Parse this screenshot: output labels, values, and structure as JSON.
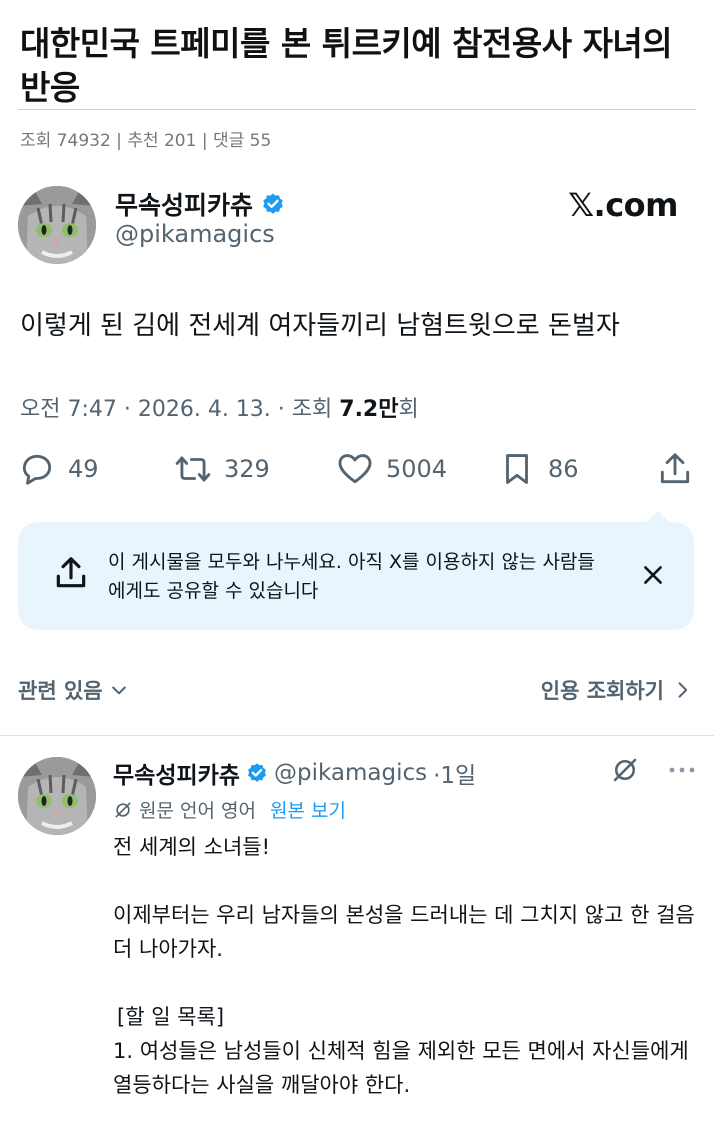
{
  "article": {
    "title": "대한민국 트페미를 본 튀르키예 참전용사 자녀의 반응",
    "views_label": "조회 74932",
    "recommend_label": "추천 201",
    "comments_label": "댓글 55",
    "separator": " | "
  },
  "tweet": {
    "name": "무속성피카츄",
    "handle": "@pikamagics",
    "site": "𝕏.com",
    "text": "이렇게 된 김에 전세계 여자들끼리 남혐트윗으로 돈벌자",
    "time_prefix": "오전 7:47 · 2026. 4. 13. · 조회 ",
    "views": "7.2만",
    "views_suffix": "회",
    "replies": "49",
    "retweets": "329",
    "likes": "5004",
    "bookmarks": "86"
  },
  "share_banner": {
    "text": "이 게시물을 모두와 나누세요. 아직 X를 이용하지 않는 사람들에게도 공유할 수 있습니다"
  },
  "related": {
    "label": "관련 있음",
    "quote_label": "인용 조회하기"
  },
  "reply": {
    "name": "무속성피카츄",
    "handle": "@pikamagics",
    "age": "·1일",
    "orig_lang": "원문 언어 영어",
    "orig_link": "원본 보기",
    "lines": {
      "l1": "전 세계의 소녀들!",
      "l2": "이제부터는 우리 남자들의 본성을 드러내는 데 그치지 않고 한 걸음 더 나아가자.",
      "l3": "[할 일 목록]",
      "l4": "1. 여성들은 남성들이 신체적 힘을 제외한 모든 면에서 자신들에게 열등하다는 사실을 깨달아야 한다."
    }
  },
  "colors": {
    "accent": "#1d9bf0",
    "muted": "#536471",
    "share_bg": "#e8f5fd"
  },
  "icons": [
    "reply-icon",
    "retweet-icon",
    "heart-icon",
    "bookmark-icon",
    "share-icon",
    "close-icon",
    "chevron-down-icon",
    "chevron-right-icon",
    "translate-off-icon",
    "more-icon",
    "verified-icon"
  ]
}
